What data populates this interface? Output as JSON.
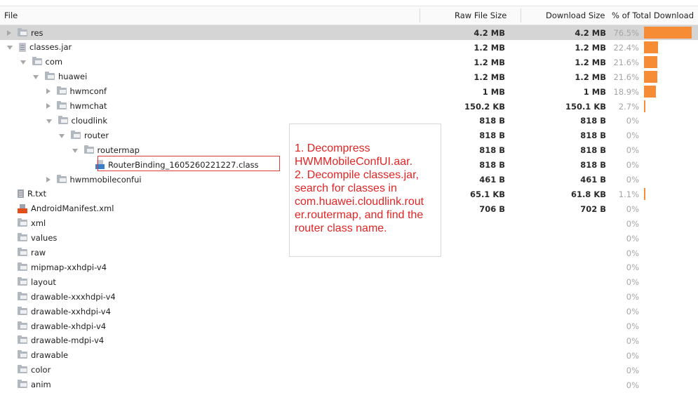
{
  "header": {
    "file": "File",
    "raw_size": "Raw File Size",
    "download_size": "Download Size",
    "percent": "% of Total Download"
  },
  "colors": {
    "bar": "#f68c36",
    "selection": "#d5d5d5",
    "annotation_text": "#e32424",
    "highlight_border": "#e03a3a"
  },
  "rows": [
    {
      "name": "res",
      "icon": "folder-icon",
      "arrow": "collapsed",
      "level": 0,
      "raw": "4.2 MB",
      "download": "4.2 MB",
      "percent": "76.5%",
      "fraction": 0.765,
      "selected": true
    },
    {
      "name": "classes.jar",
      "icon": "jar-icon",
      "arrow": "expanded",
      "level": 0,
      "raw": "1.2 MB",
      "download": "1.2 MB",
      "percent": "22.4%",
      "fraction": 0.224
    },
    {
      "name": "com",
      "icon": "folder-icon",
      "arrow": "expanded",
      "level": 1,
      "raw": "1.2 MB",
      "download": "1.2 MB",
      "percent": "21.6%",
      "fraction": 0.216
    },
    {
      "name": "huawei",
      "icon": "folder-icon",
      "arrow": "expanded",
      "level": 2,
      "raw": "1.2 MB",
      "download": "1.2 MB",
      "percent": "21.6%",
      "fraction": 0.216
    },
    {
      "name": "hwmconf",
      "icon": "folder-icon",
      "arrow": "collapsed",
      "level": 3,
      "raw": "1 MB",
      "download": "1 MB",
      "percent": "18.9%",
      "fraction": 0.189
    },
    {
      "name": "hwmchat",
      "icon": "folder-icon",
      "arrow": "collapsed",
      "level": 3,
      "raw": "150.2 KB",
      "download": "150.1 KB",
      "percent": "2.7%",
      "fraction": 0.027
    },
    {
      "name": "cloudlink",
      "icon": "folder-icon",
      "arrow": "expanded",
      "level": 3,
      "raw": "818 B",
      "download": "818 B",
      "percent": "0%",
      "fraction": 0
    },
    {
      "name": "router",
      "icon": "folder-icon",
      "arrow": "expanded",
      "level": 4,
      "raw": "818 B",
      "download": "818 B",
      "percent": "0%",
      "fraction": 0
    },
    {
      "name": "routermap",
      "icon": "folder-icon",
      "arrow": "expanded",
      "level": 5,
      "raw": "818 B",
      "download": "818 B",
      "percent": "0%",
      "fraction": 0
    },
    {
      "name": "RouterBinding_1605260221227.class",
      "icon": "class-icon",
      "arrow": "none",
      "level": 6,
      "raw": "818 B",
      "download": "818 B",
      "percent": "0%",
      "fraction": 0
    },
    {
      "name": "hwmmobileconfui",
      "icon": "folder-icon",
      "arrow": "collapsed",
      "level": 3,
      "raw": "461 B",
      "download": "461 B",
      "percent": "0%",
      "fraction": 0
    },
    {
      "name": "R.txt",
      "icon": "txt-icon",
      "arrow": "none",
      "level": 0,
      "raw": "65.1 KB",
      "download": "61.8 KB",
      "percent": "1.1%",
      "fraction": 0.011
    },
    {
      "name": "AndroidManifest.xml",
      "icon": "xml-icon",
      "arrow": "none",
      "level": 0,
      "raw": "706 B",
      "download": "702 B",
      "percent": "0%",
      "fraction": 0
    },
    {
      "name": "xml",
      "icon": "folder-icon",
      "arrow": "none",
      "level": 0,
      "raw": "",
      "download": "",
      "percent": "0%",
      "fraction": 0
    },
    {
      "name": "values",
      "icon": "folder-icon",
      "arrow": "none",
      "level": 0,
      "raw": "",
      "download": "",
      "percent": "0%",
      "fraction": 0
    },
    {
      "name": "raw",
      "icon": "folder-icon",
      "arrow": "none",
      "level": 0,
      "raw": "",
      "download": "",
      "percent": "0%",
      "fraction": 0
    },
    {
      "name": "mipmap-xxhdpi-v4",
      "icon": "folder-icon",
      "arrow": "none",
      "level": 0,
      "raw": "",
      "download": "",
      "percent": "0%",
      "fraction": 0
    },
    {
      "name": "layout",
      "icon": "folder-icon",
      "arrow": "none",
      "level": 0,
      "raw": "",
      "download": "",
      "percent": "0%",
      "fraction": 0
    },
    {
      "name": "drawable-xxxhdpi-v4",
      "icon": "folder-icon",
      "arrow": "none",
      "level": 0,
      "raw": "",
      "download": "",
      "percent": "0%",
      "fraction": 0
    },
    {
      "name": "drawable-xxhdpi-v4",
      "icon": "folder-icon",
      "arrow": "none",
      "level": 0,
      "raw": "",
      "download": "",
      "percent": "0%",
      "fraction": 0
    },
    {
      "name": "drawable-xhdpi-v4",
      "icon": "folder-icon",
      "arrow": "none",
      "level": 0,
      "raw": "",
      "download": "",
      "percent": "0%",
      "fraction": 0
    },
    {
      "name": "drawable-mdpi-v4",
      "icon": "folder-icon",
      "arrow": "none",
      "level": 0,
      "raw": "",
      "download": "",
      "percent": "0%",
      "fraction": 0
    },
    {
      "name": "drawable",
      "icon": "folder-icon",
      "arrow": "none",
      "level": 0,
      "raw": "",
      "download": "",
      "percent": "0%",
      "fraction": 0
    },
    {
      "name": "color",
      "icon": "folder-icon",
      "arrow": "none",
      "level": 0,
      "raw": "",
      "download": "",
      "percent": "0%",
      "fraction": 0
    },
    {
      "name": "anim",
      "icon": "folder-icon",
      "arrow": "none",
      "level": 0,
      "raw": "",
      "download": "",
      "percent": "0%",
      "fraction": 0
    }
  ],
  "annotation": {
    "lines": [
      "1. Decompress",
      "HWMMobileConfUI.aar.",
      "2. Decompile classes.jar,",
      "search for classes in",
      "com.huawei.cloudlink.rout",
      "er.routermap, and find the",
      "router class name."
    ]
  }
}
